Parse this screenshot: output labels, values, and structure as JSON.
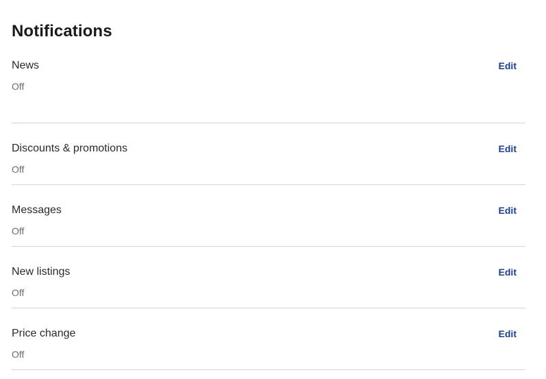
{
  "page": {
    "title": "Notifications"
  },
  "colors": {
    "link": "#1b3f8f",
    "divider": "#d3d3d3",
    "status_text": "#6b6b6b"
  },
  "notifications": [
    {
      "label": "News",
      "status": "Off",
      "action": "Edit"
    },
    {
      "label": "Discounts & promotions",
      "status": "Off",
      "action": "Edit"
    },
    {
      "label": "Messages",
      "status": "Off",
      "action": "Edit"
    },
    {
      "label": "New listings",
      "status": "Off",
      "action": "Edit"
    },
    {
      "label": "Price change",
      "status": "Off",
      "action": "Edit"
    }
  ]
}
